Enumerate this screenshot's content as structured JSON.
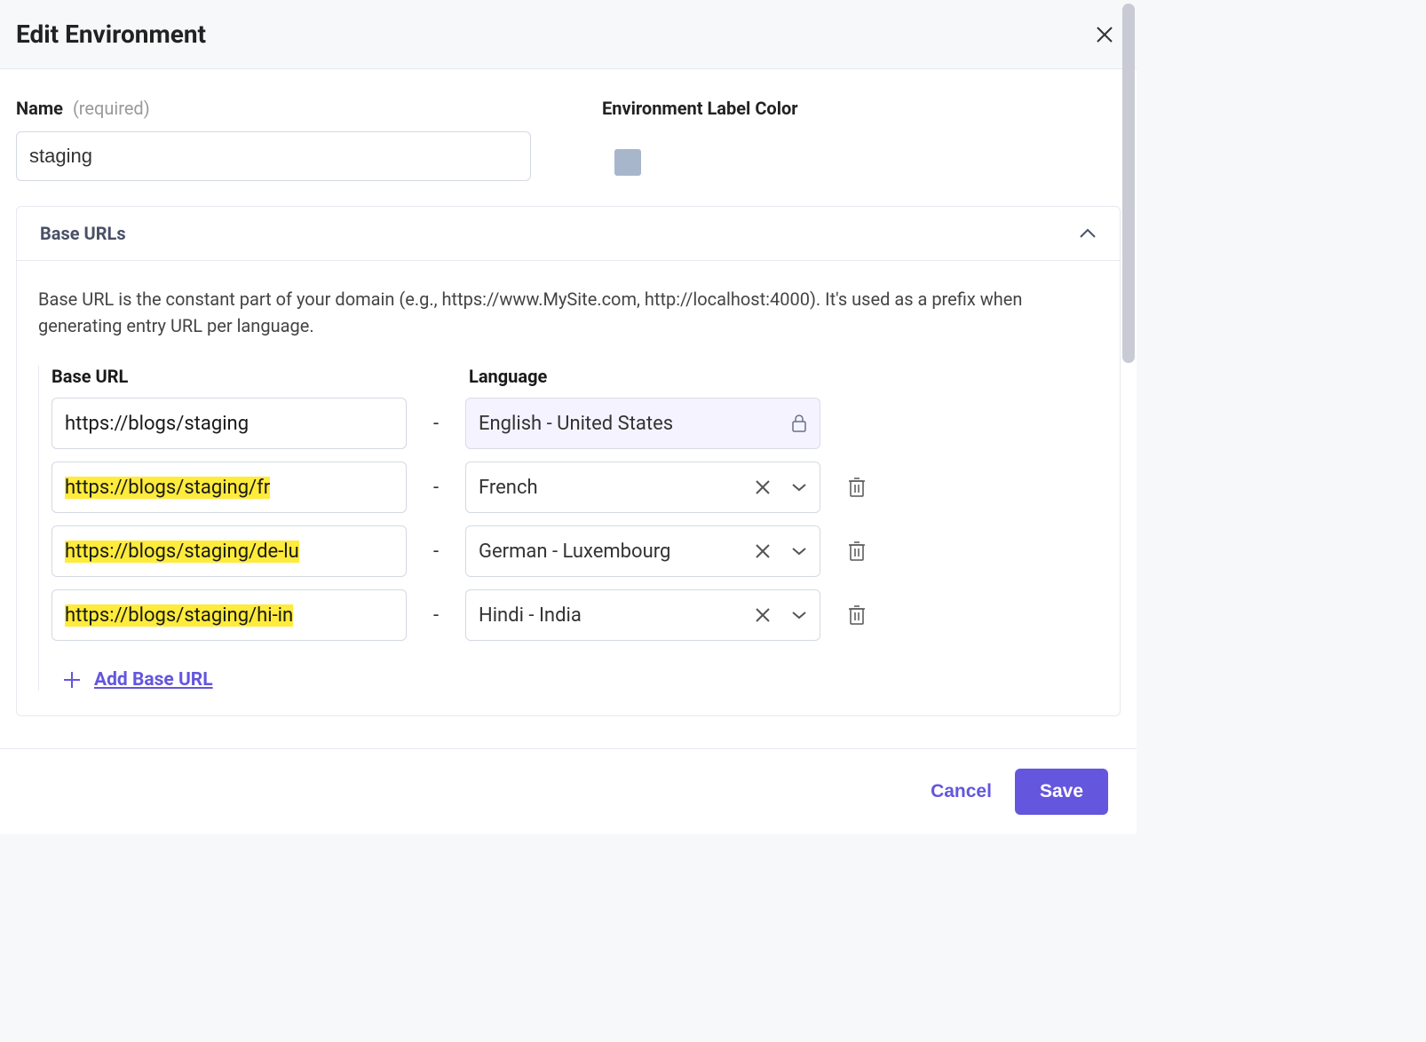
{
  "modal": {
    "title": "Edit Environment",
    "name_label": "Name",
    "required_hint": "(required)",
    "name_value": "staging",
    "color_label": "Environment Label Color",
    "color_value": "#a8b6cc"
  },
  "panel": {
    "title": "Base URLs",
    "description": "Base URL is the constant part of your domain (e.g., https://www.MySite.com, http://localhost:4000). It's used as a prefix when generating entry URL per language.",
    "col_url": "Base URL",
    "col_lang": "Language",
    "rows": [
      {
        "url": "https://blogs/staging",
        "highlighted": false,
        "language": "English - United States",
        "locked": true
      },
      {
        "url": "https://blogs/staging/fr",
        "highlighted": true,
        "language": "French",
        "locked": false
      },
      {
        "url": "https://blogs/staging/de-lu",
        "highlighted": true,
        "language": "German - Luxembourg",
        "locked": false
      },
      {
        "url": "https://blogs/staging/hi-in",
        "highlighted": true,
        "language": "Hindi - India",
        "locked": false
      }
    ],
    "add_label": "Add Base URL"
  },
  "footer": {
    "cancel": "Cancel",
    "save": "Save"
  }
}
